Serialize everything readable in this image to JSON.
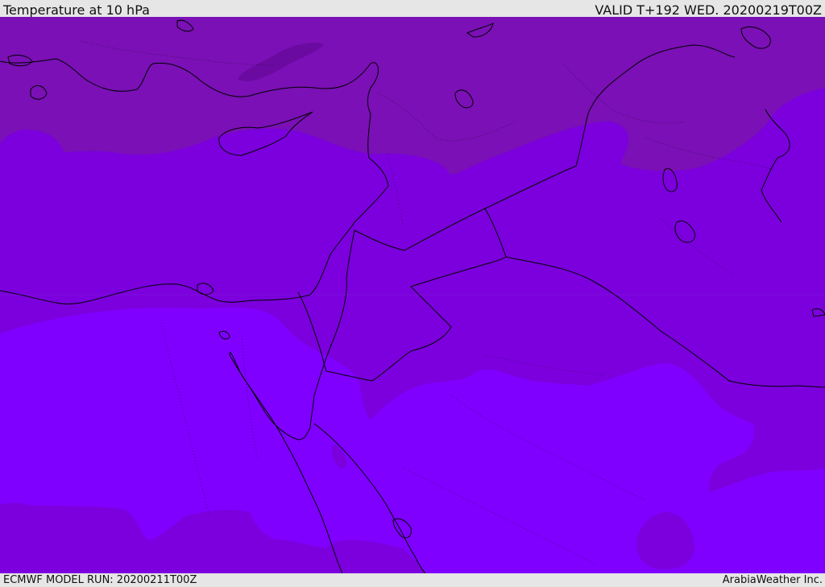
{
  "header": {
    "title": "Temperature at 10 hPa",
    "valid_time": "VALID T+192 WED. 20200219T00Z"
  },
  "footer": {
    "model_run": "ECMWF MODEL RUN: 20200211T00Z",
    "credit": "ArabiaWeather Inc."
  },
  "colors": {
    "band_cold": "#7a10b5",
    "band_mid": "#7b00dd",
    "band_warm": "#7f00ff",
    "band_coldest": "#6a0aa0",
    "coastline": "#000000",
    "background": "#e6e6e6"
  }
}
